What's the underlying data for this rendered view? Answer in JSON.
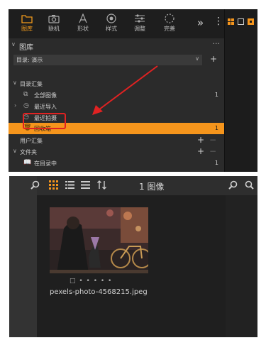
{
  "toolbar": {
    "tools": [
      {
        "label": "图库",
        "icon": "folder-icon",
        "active": true
      },
      {
        "label": "联机",
        "icon": "camera-icon",
        "active": false
      },
      {
        "label": "形状",
        "icon": "shape-icon",
        "active": false
      },
      {
        "label": "样式",
        "icon": "style-icon",
        "active": false
      },
      {
        "label": "调整",
        "icon": "adjust-icon",
        "active": false
      },
      {
        "label": "完善",
        "icon": "refine-icon",
        "active": false
      }
    ],
    "more_arrows": "»",
    "more_dots": "⋮"
  },
  "library": {
    "title": "图库",
    "menu": "···",
    "directory_label": "目录: 演示",
    "add": "+"
  },
  "tree": {
    "catalog_section": "目录汇集",
    "all_images": "全部图像",
    "all_images_count": "1",
    "recent_import": "最近导入",
    "recent_shot": "最近拍摄",
    "trash": "回收箱",
    "trash_count": "1",
    "user_collections": "用户汇集",
    "folders": "文件夹",
    "in_catalog": "在目录中",
    "in_catalog_count": "1",
    "plus": "+",
    "minus": "−"
  },
  "browser": {
    "image_count": "1 图像",
    "photo_dots": "□ • • • • •",
    "filename": "pexels-photo-4568215.jpeg"
  },
  "colors": {
    "accent": "#f5951c",
    "highlight_box": "#e02222",
    "panel_bg": "#2b2b2b"
  }
}
